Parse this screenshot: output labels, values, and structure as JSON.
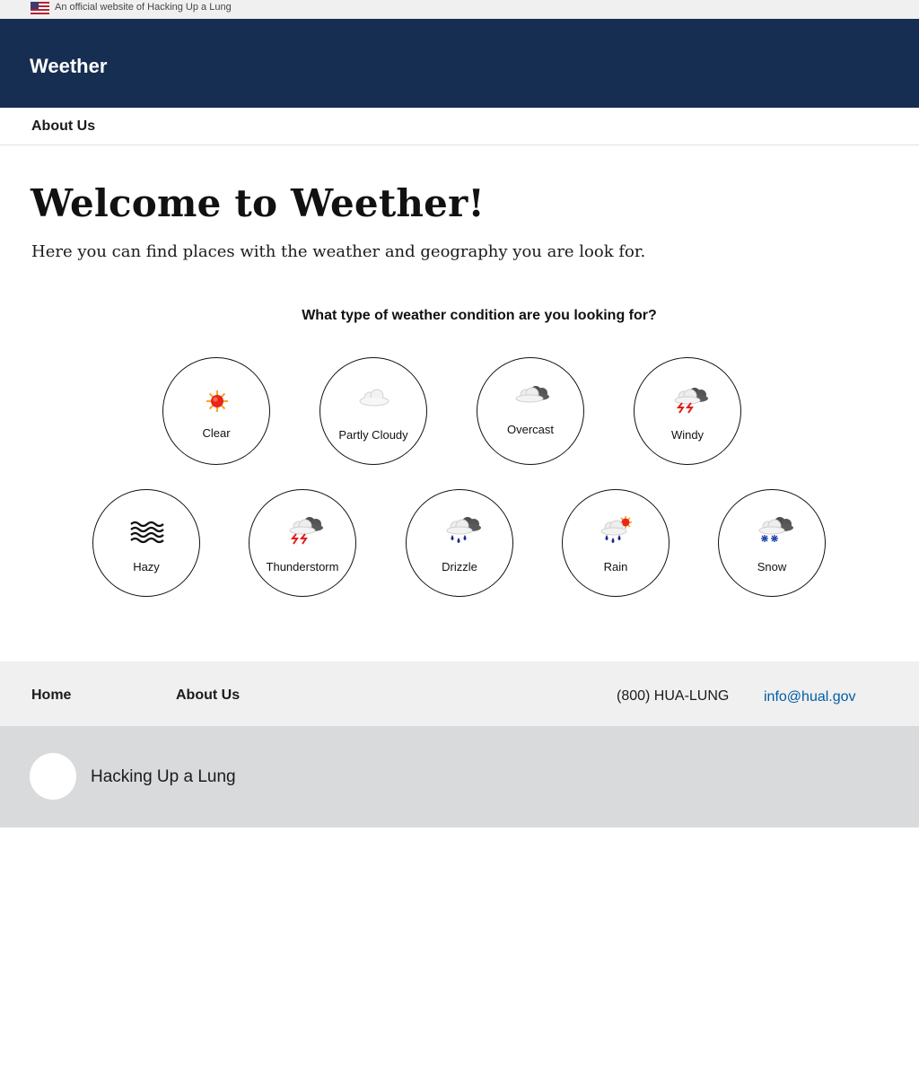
{
  "banner": {
    "text": "An official website of Hacking Up a Lung",
    "icon": "us-flag-icon"
  },
  "header": {
    "site_title": "Weether"
  },
  "nav": {
    "items": [
      {
        "label": "About Us"
      }
    ]
  },
  "hero": {
    "title": "Welcome to Weether!",
    "subtitle": "Here you can find places with the weather and geography you are look for."
  },
  "question": "What type of weather condition are you looking for?",
  "conditions": [
    {
      "label": "Clear",
      "icon": "sun-icon"
    },
    {
      "label": "Partly Cloudy",
      "icon": "cloud-icon"
    },
    {
      "label": "Overcast",
      "icon": "overcast-icon"
    },
    {
      "label": "Windy",
      "icon": "storm-cloud-icon"
    },
    {
      "label": "Hazy",
      "icon": "haze-icon"
    },
    {
      "label": "Thunderstorm",
      "icon": "thunderstorm-icon"
    },
    {
      "label": "Drizzle",
      "icon": "drizzle-icon"
    },
    {
      "label": "Rain",
      "icon": "rain-icon"
    },
    {
      "label": "Snow",
      "icon": "snow-icon"
    }
  ],
  "footer": {
    "links": [
      {
        "label": "Home"
      },
      {
        "label": "About Us"
      }
    ],
    "phone": "(800) HUA-LUNG",
    "email": "info@hual.gov",
    "org_name": "Hacking Up a Lung"
  },
  "colors": {
    "header_bg": "#162e51",
    "banner_bg": "#f0f0f0",
    "footer_nav_bg": "#f0f0f0",
    "footer_bottom_bg": "#d9dadb",
    "link": "#005ea2"
  }
}
